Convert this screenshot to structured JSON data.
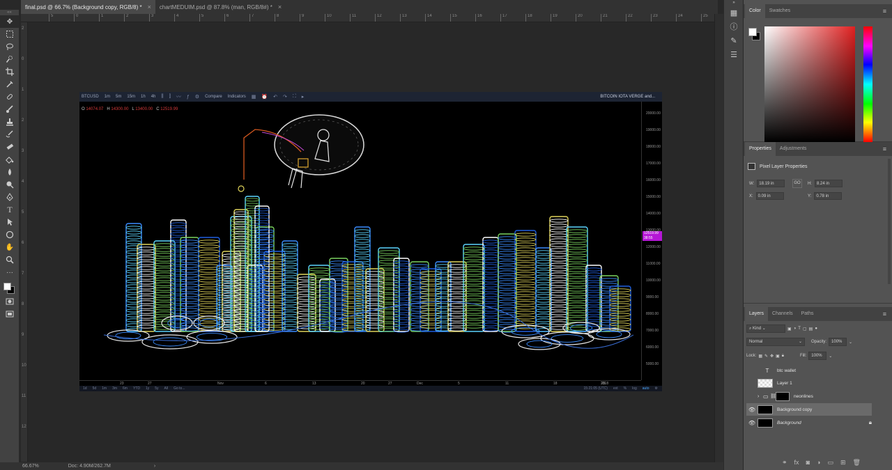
{
  "tabs": [
    {
      "label": "final.psd @ 66.7% (Background copy, RGB/8) *",
      "active": true
    },
    {
      "label": "chartMEDUIM.psd @ 87.8% (man, RGB/8#) *",
      "active": false
    }
  ],
  "tools": [
    "move-icon",
    "marquee-icon",
    "lasso-icon",
    "quick-select-icon",
    "crop-icon",
    "eyedropper-icon",
    "healing-icon",
    "brush-icon",
    "stamp-icon",
    "history-brush-icon",
    "eraser-icon",
    "paint-bucket-icon",
    "blur-icon",
    "dodge-icon",
    "pen-icon",
    "type-icon",
    "path-select-icon",
    "shape-icon",
    "hand-icon",
    "zoom-icon",
    "more-icon"
  ],
  "ruler": {
    "top": [
      "5",
      "0",
      "1",
      "2",
      "3",
      "4",
      "5",
      "6",
      "7",
      "8",
      "9",
      "10",
      "11",
      "12",
      "13",
      "14",
      "15",
      "16",
      "17",
      "18",
      "19",
      "20",
      "21",
      "22",
      "23",
      "24",
      "25",
      "26"
    ],
    "left": [
      "2",
      "0",
      "1",
      "2",
      "3",
      "4",
      "5",
      "6",
      "7",
      "8",
      "9",
      "10",
      "11",
      "12"
    ]
  },
  "chart": {
    "symbol": "BTCUSD",
    "intervals": [
      "1m",
      "5m",
      "15m",
      "1h",
      "4h"
    ],
    "compare_label": "Compare",
    "indicators_label": "Indicators",
    "title": "BITCOIN IOTA VERGE and...",
    "ohlc": {
      "o_label": "O",
      "o": "14074.07",
      "h_label": "H",
      "h": "14300.00",
      "l_label": "L",
      "l": "13400.00",
      "c_label": "C",
      "c": "12519.99"
    },
    "price_ticks": [
      "20000.00",
      "19000.00",
      "18000.00",
      "17000.00",
      "16000.00",
      "15000.00",
      "14000.00",
      "13000.00",
      "12000.00",
      "11000.00",
      "10000.00",
      "9000.00",
      "8000.00",
      "7000.00",
      "6000.00",
      "5000.00"
    ],
    "current_price": "12519.99",
    "current_time": "38:55",
    "date_ticks": [
      "23",
      "27",
      "Nov",
      "6",
      "13",
      "20",
      "27",
      "Dec",
      "5",
      "11",
      "18",
      "25",
      "2018"
    ],
    "ranges": [
      "1d",
      "5d",
      "1m",
      "3m",
      "6m",
      "YTD",
      "1y",
      "5y",
      "All",
      "Go to..."
    ],
    "clock": "15:21:05 (UTC)",
    "scale_opts": [
      "ext",
      "%",
      "log",
      "auto"
    ]
  },
  "right_icons": [
    "history-icon",
    "info-icon",
    "brush-settings-icon",
    "adjustments-icon"
  ],
  "color_panel": {
    "tabs": [
      "Color",
      "Swatches"
    ]
  },
  "properties": {
    "tabs": [
      "Properties",
      "Adjustments"
    ],
    "title": "Pixel Layer Properties",
    "w_label": "W:",
    "w": "18.19 in",
    "h_label": "H:",
    "h": "8.24 in",
    "x_label": "X:",
    "x": "0.09 in",
    "y_label": "Y:",
    "y": "0.78 in",
    "link": "GO"
  },
  "layers_panel": {
    "tabs": [
      "Layers",
      "Channels",
      "Paths"
    ],
    "kind": "Kind",
    "blend_mode": "Normal",
    "opacity_label": "Opacity:",
    "opacity": "100%",
    "lock_label": "Lock:",
    "fill_label": "Fill:",
    "fill": "100%",
    "layers": [
      {
        "name": "btc wallet",
        "type": "text",
        "visible": false
      },
      {
        "name": "Layer 1",
        "type": "pixel",
        "visible": false
      },
      {
        "name": "neonlines",
        "type": "group",
        "visible": false
      },
      {
        "name": "Background copy",
        "type": "pixel",
        "visible": true,
        "selected": true
      },
      {
        "name": "Background",
        "type": "background",
        "visible": true,
        "locked": true
      }
    ]
  },
  "status": {
    "zoom": "66.67%",
    "doc": "Doc: 4.90M/262.7M"
  }
}
